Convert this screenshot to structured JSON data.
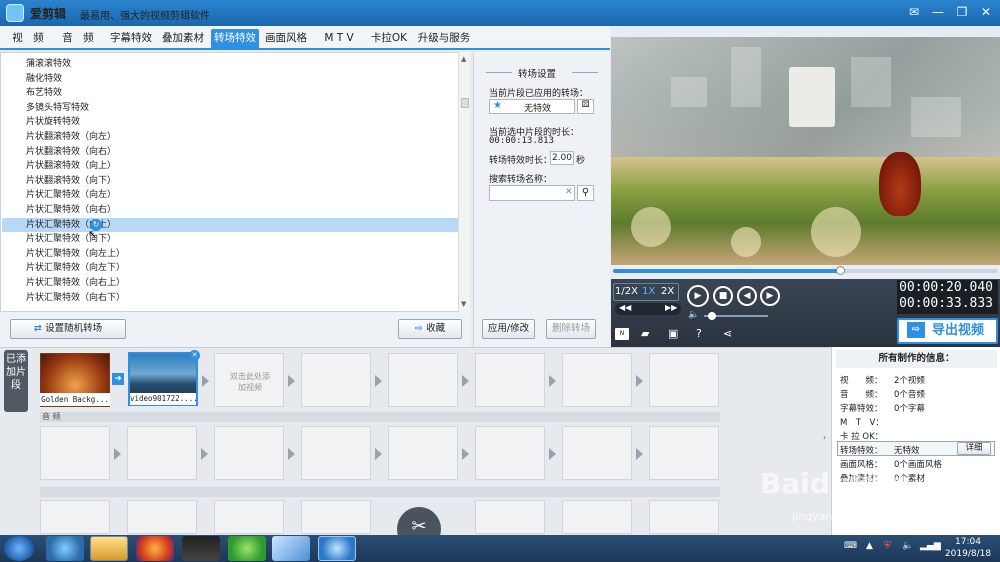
{
  "app": {
    "title": "爱剪辑",
    "slogan": "最易用、强大的视频剪辑软件"
  },
  "tabs": [
    "视　频",
    "音　频",
    "字幕特效",
    "叠加素材",
    "转场特效",
    "画面风格",
    "M T V",
    "卡拉OK",
    "升级与服务"
  ],
  "effects": {
    "items": [
      "蒲滚滚特效",
      "融化特效",
      "布艺特效",
      "多镜头特写特效",
      "片状旋转特效",
      "片状翻滚特效（向左）",
      "片状翻滚特效（向右）",
      "片状翻滚特效（向上）",
      "片状翻滚特效（向下）",
      "片状汇聚特效（向左）",
      "片状汇聚特效（向右）",
      "片状汇聚特效（向上）",
      "片状汇聚特效（向下）",
      "片状汇聚特效（向左上）",
      "片状汇聚特效（向左下）",
      "片状汇聚特效（向右上）",
      "片状汇聚特效（向右下）"
    ],
    "selected_index": 11,
    "random_button": "设置随机转场",
    "collect_button": "收藏"
  },
  "settings": {
    "header": "转场设置",
    "applied_label": "当前片段已应用的转场：",
    "applied_value": "无特效",
    "duration_label": "当前选中片段的时长：",
    "duration_value": "00:00:13.813",
    "effect_duration_label": "转场特效时长：",
    "effect_duration_value": "2.00",
    "effect_duration_unit": "秒",
    "search_label": "搜索转场名称：",
    "apply_button": "应用/修改",
    "delete_button": "删除转场"
  },
  "player": {
    "speeds": [
      "1/2X",
      "1X",
      "2X"
    ],
    "progress": 0.59,
    "current_time": "00:00:20.040",
    "total_time": "00:00:33.833",
    "export_button": "导出视频"
  },
  "timeline": {
    "side_tab": "已添加片段",
    "clips": [
      "Golden Backg...",
      "video901722...."
    ],
    "add_hint": "双击此处添加视频",
    "audio_label": "音 频"
  },
  "info": {
    "header": "所有制作的信息：",
    "rows": [
      {
        "k": "视　　频：",
        "v": "2个视频"
      },
      {
        "k": "音　　频：",
        "v": "0个音频"
      },
      {
        "k": "字幕特效：",
        "v": "0个字幕"
      },
      {
        "k": "M　T　V：",
        "v": ""
      },
      {
        "k": "卡 拉 OK：",
        "v": ""
      },
      {
        "k": "转场特效：",
        "v": "无特效"
      },
      {
        "k": "画面风格：",
        "v": "0个画面风格"
      },
      {
        "k": "叠加素材：",
        "v": "0个素材"
      }
    ],
    "detail_button": "详细"
  },
  "taskbar": {
    "time": "17:04",
    "date": "2019/8/18"
  },
  "watermark": {
    "brand": "Baidu经验",
    "url": "jingyan.baidu.com"
  }
}
